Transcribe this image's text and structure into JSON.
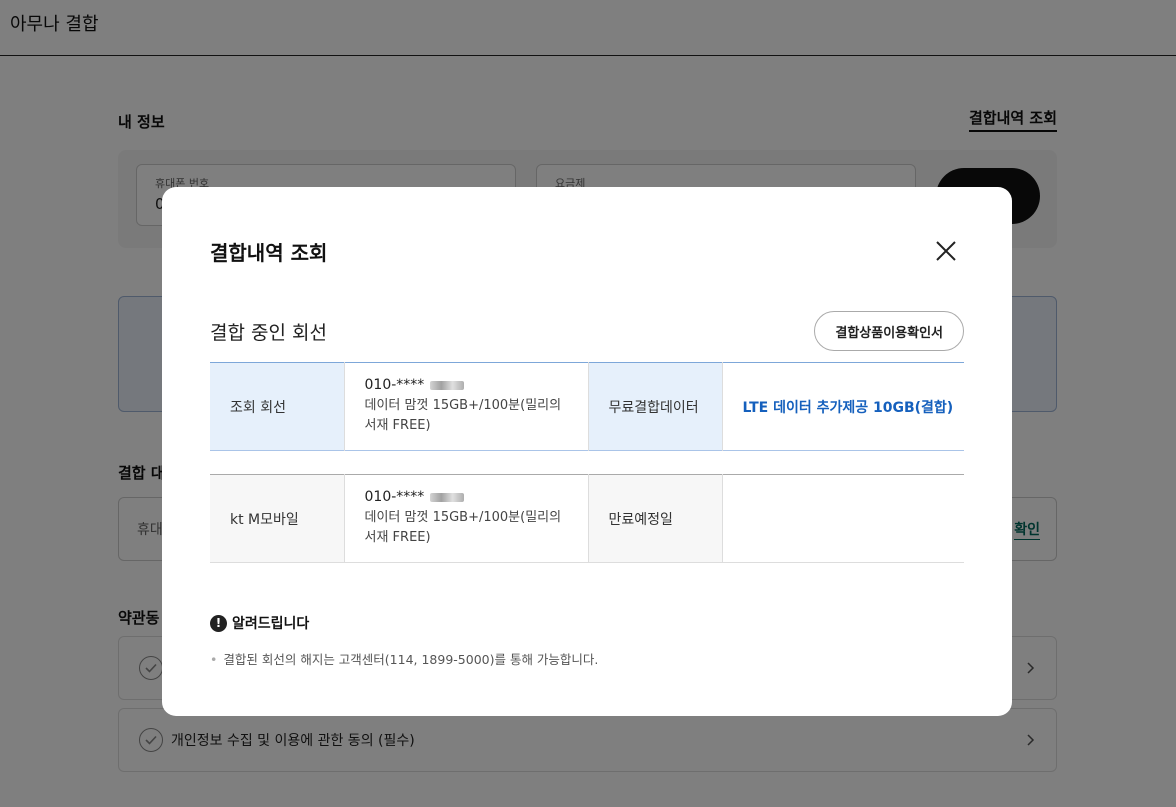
{
  "page": {
    "title": "아무나 결합",
    "my_info_title": "내 정보",
    "history_link": "결합내역 조회",
    "phone_label": "휴대폰 번호",
    "phone_value": "0",
    "plan_label": "요금제",
    "target_title": "결합 대",
    "target_placeholder": "휴대",
    "target_action": "확인",
    "terms_title": "약관동",
    "terms": [
      {
        "label": ""
      },
      {
        "label": "개인정보 수집 및 이용에 관한 동의 (필수)"
      }
    ]
  },
  "modal": {
    "title": "결합내역 조회",
    "section_title": "결합 중인 회선",
    "confirm_button": "결합상품이용확인서",
    "rows": [
      {
        "header": "조회 회선",
        "number": "010-****",
        "plan": "데이터 맘껏 15GB+/100분(밀리의 서재 FREE)",
        "value_header": "무료결합데이터",
        "value": "LTE 데이터 추가제공 10GB(결합)"
      },
      {
        "header": "kt M모바일",
        "number": "010-****",
        "plan": "데이터 맘껏 15GB+/100분(밀리의 서재 FREE)",
        "value_header": "만료예정일",
        "value": ""
      }
    ],
    "notice_title": "알려드립니다",
    "notice_text": "결합된 회선의 해지는 고객센터(114, 1899-5000)를 통해 가능합니다."
  },
  "colors": {
    "accent_blue": "#1560bd",
    "header_blue_bg": "#e6f0fb",
    "link_green": "#00695c"
  }
}
